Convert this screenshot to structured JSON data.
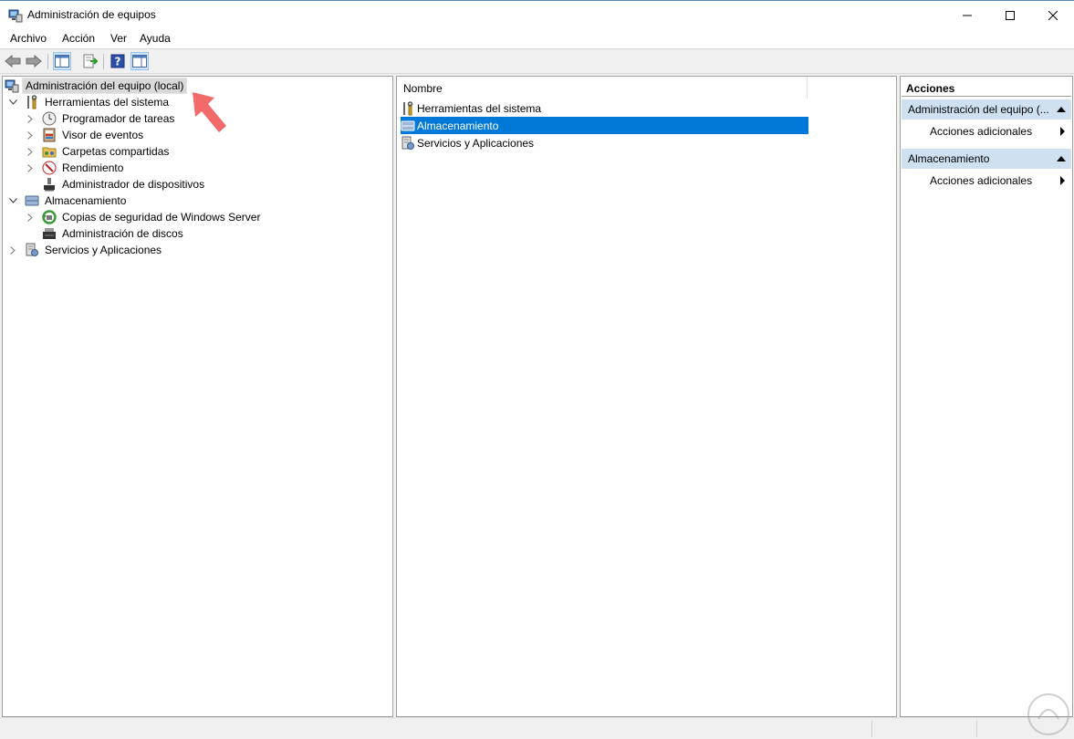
{
  "window": {
    "title": "Administración de equipos",
    "minimize_glyph": "—",
    "maximize_glyph": "☐",
    "close_glyph": "✕"
  },
  "menu": [
    "Archivo",
    "Acción",
    "Ver",
    "Ayuda"
  ],
  "toolbar": {
    "buttons": [
      "back-arrow-icon",
      "forward-arrow-icon",
      "show-hide-tree-icon",
      "export-list-icon",
      "help-icon",
      "show-hide-actions-icon"
    ]
  },
  "tree": {
    "root": "Administración del equipo (local)",
    "groups": [
      {
        "label": "Herramientas del sistema",
        "expanded": true,
        "children": [
          {
            "label": "Programador de tareas",
            "expandable": true
          },
          {
            "label": "Visor de eventos",
            "expandable": true
          },
          {
            "label": "Carpetas compartidas",
            "expandable": true
          },
          {
            "label": "Rendimiento",
            "expandable": true
          },
          {
            "label": "Administrador de dispositivos",
            "expandable": false
          }
        ]
      },
      {
        "label": "Almacenamiento",
        "expanded": true,
        "children": [
          {
            "label": "Copias de seguridad de Windows Server",
            "expandable": true
          },
          {
            "label": "Administración de discos",
            "expandable": false
          }
        ]
      },
      {
        "label": "Servicios y Aplicaciones",
        "expanded": false,
        "children": []
      }
    ]
  },
  "list": {
    "column_name": "Nombre",
    "items": [
      {
        "label": "Herramientas del sistema",
        "selected": false
      },
      {
        "label": "Almacenamiento",
        "selected": true
      },
      {
        "label": "Servicios y Aplicaciones",
        "selected": false
      }
    ]
  },
  "actions": {
    "header": "Acciones",
    "sections": [
      {
        "title": "Administración del equipo (...",
        "item": "Acciones adicionales"
      },
      {
        "title": "Almacenamiento",
        "item": "Acciones adicionales"
      }
    ]
  },
  "colors": {
    "selection": "#0078d7",
    "actions_section_bg": "#cfe0f1",
    "pointer": "#f26a6a"
  }
}
